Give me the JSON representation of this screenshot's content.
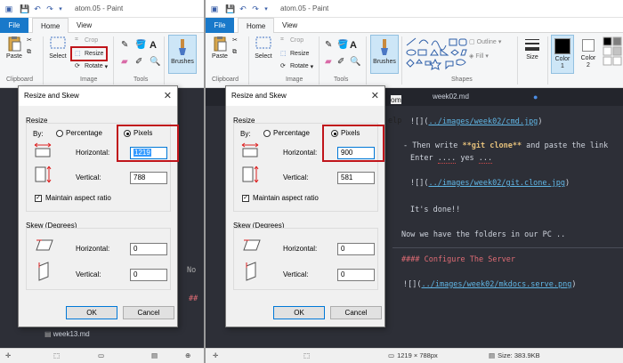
{
  "window": {
    "title": "atom.05 - Paint",
    "tabs": [
      "File",
      "Home",
      "View"
    ]
  },
  "ribbon": {
    "paste": "Paste",
    "select": "Select",
    "crop": "Crop",
    "resize": "Resize",
    "rotate": "Rotate",
    "brushes": "Brushes",
    "outline": "Outline",
    "fill": "Fill",
    "size": "Size",
    "color1": "Color\n1",
    "color2": "Color\n2",
    "groups": {
      "clipboard": "Clipboard",
      "image": "Image",
      "tools": "Tools",
      "shapes": "Shapes"
    }
  },
  "dialog": {
    "title": "Resize and Skew",
    "resize_title": "Resize",
    "by_label": "By:",
    "percentage_label": "Percentage",
    "pixels_label": "Pixels",
    "horizontal_label": "Horizontal:",
    "vertical_label": "Vertical:",
    "maintain_label": "Maintain aspect ratio",
    "skew_title": "Skew (Degrees)",
    "ok_label": "OK",
    "cancel_label": "Cancel",
    "left": {
      "horizontal": "1219",
      "vertical": "788",
      "skew_h": "0",
      "skew_v": "0"
    },
    "right": {
      "horizontal": "900",
      "vertical": "581",
      "skew_h": "0",
      "skew_v": "0"
    }
  },
  "editor": {
    "left_file_item": "week13.md",
    "left_partial_label": "No",
    "left_partial_heading": "##",
    "tab_label": "week02.md",
    "right_partial_menu": "elp",
    "right_partial_title": "om",
    "lines": {
      "l1_link": "../images/week02/cmd.jpg",
      "l2_a": "- Then write ",
      "l2_bold": "**git clone**",
      "l2_b": " and paste the link",
      "l3_a": "Enter ",
      "l3_sq1": "....",
      "l3_b": " yes ",
      "l3_sq2": "...",
      "l4_link": "../images/week02/git.clone.jpg",
      "l5": "It's done!!",
      "l6": "Now we have the folders in our PC ..",
      "l7": "#### Configure The Server",
      "l8_link": "../images/week02/mkdocs.serve.png"
    }
  },
  "status": {
    "dimensions": "1219 × 788px",
    "size": "Size: 383.9KB"
  },
  "colors": {
    "accent": "#1979ca",
    "highlight": "#c0151b",
    "editor_bg": "#2d2f37"
  }
}
